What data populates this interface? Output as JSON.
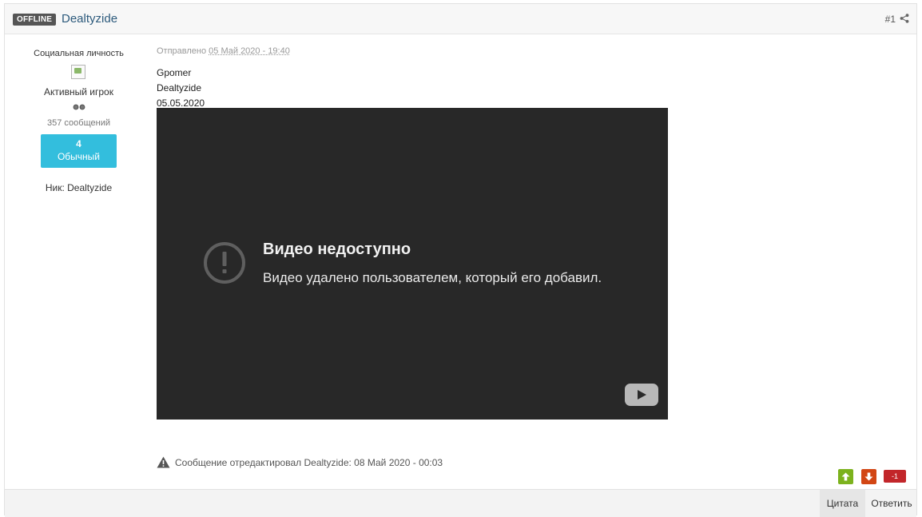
{
  "header": {
    "status_badge": "OFFLINE",
    "author": "Dealtyzide",
    "post_number": "#1"
  },
  "author_panel": {
    "title": "Социальная личность",
    "group": "Активный игрок",
    "posts": "357 сообщений",
    "reputation_value": "4",
    "reputation_label": "Обычный",
    "nick": "Ник: Dealtyzide"
  },
  "post": {
    "date_prefix": "Отправлено",
    "date": "05 Май 2020 - 19:40",
    "lines": [
      "Gpomer",
      "Dealtyzide",
      "05.05.2020"
    ],
    "video_title": "Видео недоступно",
    "video_message": "Видео удалено пользователем, который его добавил.",
    "edit_note": "Сообщение отредактировал Dealtyzide: 08 Май 2020 - 00:03",
    "rep_count": "-1"
  },
  "footer": {
    "quote_label": "Цитата",
    "reply_label": "Ответить"
  },
  "colors": {
    "reputation_bg": "#33bedd",
    "vote_up": "#7cb21d",
    "vote_down": "#d24614",
    "rep_negative": "#c2262a"
  },
  "icons": [
    "share-icon",
    "exclamation-circle-icon",
    "youtube-play-icon",
    "warning-triangle-icon",
    "arrow-up-icon",
    "arrow-down-icon"
  ]
}
